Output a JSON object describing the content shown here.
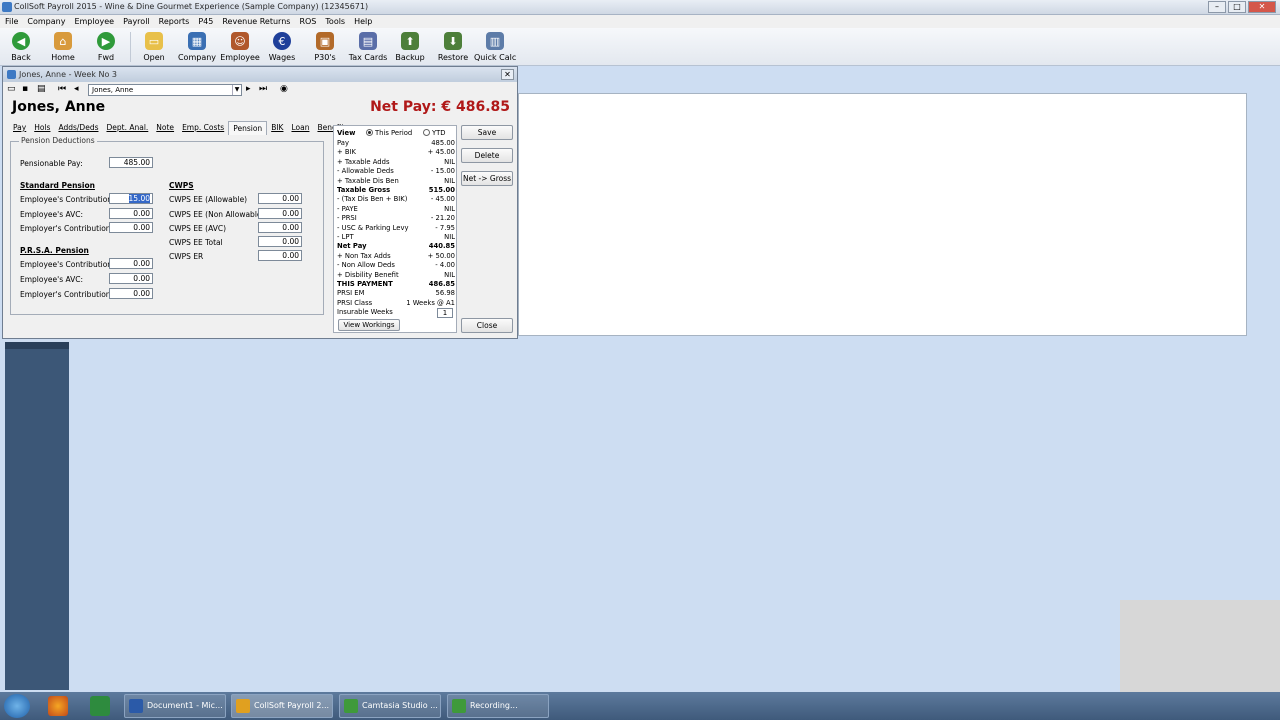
{
  "app": {
    "title": "CollSoft Payroll 2015 - Wine & Dine Gourmet Experience (Sample Company) (12345671)"
  },
  "menu": [
    "File",
    "Company",
    "Employee",
    "Payroll",
    "Reports",
    "P45",
    "Revenue Returns",
    "ROS",
    "Tools",
    "Help"
  ],
  "toolbar": [
    {
      "label": "Back",
      "icon": "back-arrow-icon",
      "color": "#2f9a3a"
    },
    {
      "label": "Home",
      "icon": "home-icon",
      "color": "#d89a3c"
    },
    {
      "label": "Fwd",
      "icon": "forward-arrow-icon",
      "color": "#2f9a3a"
    },
    {
      "label": "Open",
      "icon": "folder-icon",
      "color": "#e8c04a"
    },
    {
      "label": "Company",
      "icon": "company-icon",
      "color": "#3a6fb3"
    },
    {
      "label": "Employee",
      "icon": "employee-icon",
      "color": "#b0582c"
    },
    {
      "label": "Wages",
      "icon": "euro-icon",
      "color": "#1e3f9a"
    },
    {
      "label": "P30's",
      "icon": "briefcase-icon",
      "color": "#b26a2a"
    },
    {
      "label": "Tax Cards",
      "icon": "tax-cards-icon",
      "color": "#5a6ea8"
    },
    {
      "label": "Backup",
      "icon": "backup-icon",
      "color": "#4d7f3a"
    },
    {
      "label": "Restore",
      "icon": "restore-icon",
      "color": "#4d7f3a"
    },
    {
      "label": "Quick Calc",
      "icon": "calculator-icon",
      "color": "#5d7ca8"
    }
  ],
  "form": {
    "window_title": "Jones, Anne - Week No 3",
    "employee_select": "Jones, Anne",
    "employee_name": "Jones, Anne",
    "net_pay": "Net Pay: € 486.85",
    "tabs": [
      "Pay",
      "Hols",
      "Adds/Deds",
      "Dept. Anal.",
      "Note",
      "Emp. Costs",
      "Pension",
      "BIK",
      "Loan",
      "Benefits"
    ],
    "active_tab": "Pension",
    "group_title": "Pension Deductions",
    "pensionable_pay_label": "Pensionable Pay:",
    "pensionable_pay": "485.00",
    "standard_pension_header": "Standard Pension",
    "standard": [
      {
        "label": "Employee's Contribution:",
        "value": "15.00"
      },
      {
        "label": "Employee's AVC:",
        "value": "0.00"
      },
      {
        "label": "Employer's Contribution:",
        "value": "0.00"
      }
    ],
    "prsa_header": "P.R.S.A. Pension",
    "prsa": [
      {
        "label": "Employee's Contribution:",
        "value": "0.00"
      },
      {
        "label": "Employee's AVC:",
        "value": "0.00"
      },
      {
        "label": "Employer's Contribution:",
        "value": "0.00"
      }
    ],
    "cwps_header": "CWPS",
    "cwps": [
      {
        "label": "CWPS EE (Allowable)",
        "value": "0.00"
      },
      {
        "label": "CWPS EE (Non Allowable)",
        "value": "0.00"
      },
      {
        "label": "CWPS EE (AVC)",
        "value": "0.00"
      },
      {
        "label": "CWPS EE Total",
        "value": "0.00"
      },
      {
        "label": "CWPS ER",
        "value": "0.00"
      }
    ]
  },
  "summary": {
    "view_label": "View",
    "this_period": "This Period",
    "ytd": "YTD",
    "rows": [
      {
        "k": "Pay",
        "v": "485.00",
        "bold": false
      },
      {
        "k": "+ BIK",
        "v": "+ 45.00",
        "bold": false
      },
      {
        "k": "+ Taxable Adds",
        "v": "NIL",
        "bold": false
      },
      {
        "k": "- Allowable Deds",
        "v": "- 15.00",
        "bold": false
      },
      {
        "k": "+ Taxable Dis Ben",
        "v": "NIL",
        "bold": false
      },
      {
        "k": "Taxable Gross",
        "v": "515.00",
        "bold": true
      },
      {
        "k": "- (Tax Dis Ben + BIK)",
        "v": "- 45.00",
        "bold": false
      },
      {
        "k": "- PAYE",
        "v": "NIL",
        "bold": false
      },
      {
        "k": "- PRSI",
        "v": "- 21.20",
        "bold": false
      },
      {
        "k": "- USC & Parking Levy",
        "v": "- 7.95",
        "bold": false
      },
      {
        "k": "- LPT",
        "v": "NIL",
        "bold": false
      },
      {
        "k": "Net Pay",
        "v": "440.85",
        "bold": true
      },
      {
        "k": "+ Non Tax Adds",
        "v": "+ 50.00",
        "bold": false
      },
      {
        "k": "- Non Allow Deds",
        "v": "- 4.00",
        "bold": false
      },
      {
        "k": "+ Disbility Benefit",
        "v": "NIL",
        "bold": false
      },
      {
        "k": "THIS PAYMENT",
        "v": "486.85",
        "bold": true
      },
      {
        "k": "PRSI EM",
        "v": "56.98",
        "bold": false
      },
      {
        "k": "PRSI Class",
        "v": "1 Weeks @ A1",
        "bold": false
      }
    ],
    "insurable_weeks_label": "Insurable Weeks",
    "insurable_weeks": "1",
    "view_workings": "View Workings"
  },
  "buttons": {
    "save": "Save",
    "delete": "Delete",
    "net_gross": "Net -> Gross",
    "close": "Close"
  },
  "taskbar": [
    {
      "label": "Document1 - Mic...",
      "color": "#2b5aa8"
    },
    {
      "label": "CollSoft Payroll 2...",
      "color": "#e0a020",
      "active": true
    },
    {
      "label": "Camtasia Studio ...",
      "color": "#3f9a3a"
    },
    {
      "label": "Recording...",
      "color": "#3f9a3a"
    }
  ]
}
